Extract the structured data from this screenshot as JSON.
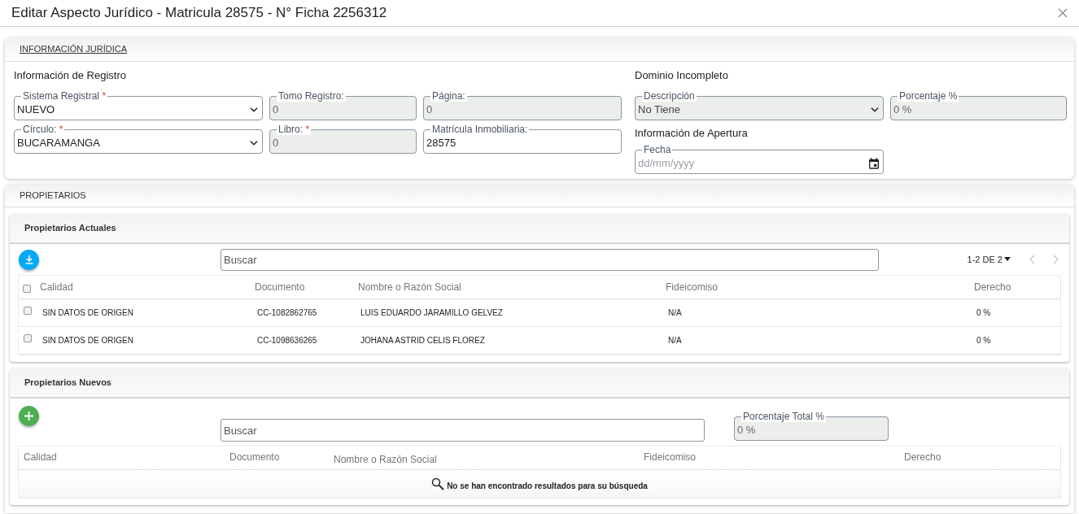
{
  "dialog": {
    "title": "Editar Aspecto Jurídico - Matricula 28575 - N° Ficha 2256312"
  },
  "legal_info": {
    "heading": "INFORMACIÓN JURÍDICA",
    "registry": {
      "title": "Información de Registro",
      "fields": [
        {
          "kind": "select",
          "label": "Sistema Registral",
          "required_mark": "*",
          "value": "NUEVO",
          "disabled": false
        },
        {
          "kind": "text",
          "label": "Tomo Registro:",
          "value": "0",
          "disabled": true
        },
        {
          "kind": "text",
          "label": "Página:",
          "value": "0",
          "disabled": true
        },
        {
          "kind": "select",
          "label": "Círculo:",
          "required_mark": "*",
          "value": "BUCARAMANGA",
          "disabled": false
        },
        {
          "kind": "text",
          "label": "Libro:",
          "required_mark": "*",
          "value": "0",
          "disabled": true
        },
        {
          "kind": "text",
          "label": "Matrícula Inmobiliaria:",
          "value": "28575",
          "disabled": false
        }
      ]
    },
    "domain": {
      "title": "Dominio Incompleto",
      "fields": [
        {
          "kind": "select",
          "label": "Descripción",
          "value": "No Tiene",
          "disabled": true
        },
        {
          "kind": "text",
          "label": "Porcentaje %",
          "value": "0 %",
          "disabled": true
        }
      ]
    },
    "opening": {
      "title": "Información de Apertura",
      "fields": [
        {
          "kind": "date",
          "label": "Fecha",
          "placeholder": "dd/mm/yyyy",
          "disabled": false
        }
      ]
    }
  },
  "owners": {
    "heading": "PROPIETARIOS",
    "current": {
      "title": "Propietarios Actuales",
      "search": {
        "placeholder": "Buscar"
      },
      "pagination": {
        "range": "1-2 DE 2"
      },
      "select_all": {
        "checked": false
      },
      "columns": [
        "Calidad",
        "Documento",
        "Nombre o Razón Social",
        "Fideicomiso",
        "Derecho"
      ],
      "rows": [
        {
          "checked": false,
          "cells": [
            "SIN DATOS DE ORIGEN",
            "CC-1082862765",
            "LUIS EDUARDO JARAMILLO GELVEZ",
            "N/A",
            "0 %"
          ]
        },
        {
          "checked": false,
          "cells": [
            "SIN DATOS DE ORIGEN",
            "CC-1098636265",
            "JOHANA ASTRID CELIS FLOREZ",
            "N/A",
            "0 %"
          ]
        }
      ]
    },
    "new": {
      "title": "Propietarios Nuevos",
      "search": {
        "placeholder": "Buscar"
      },
      "total_field": {
        "label": "Porcentaje Total %",
        "value": "0 %",
        "disabled": true
      },
      "columns": [
        "Calidad",
        "Documento",
        "Nombre o Razón Social",
        "Fideicomiso",
        "Derecho"
      ],
      "empty_message": "No se han encontrado resultados para su búsqueda"
    }
  }
}
